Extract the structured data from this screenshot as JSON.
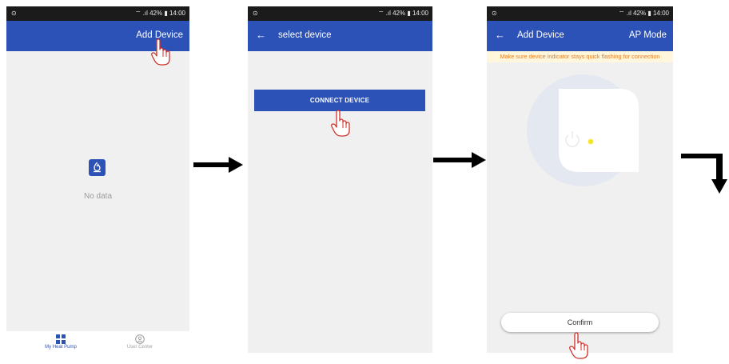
{
  "colors": {
    "accent": "#2c51b7",
    "status_bar": "#1b1b1b",
    "screen_bg": "#f0f0f0",
    "warning_text": "#e67e22",
    "warning_bg": "#fff6dc",
    "pointer_hand": "#d03028",
    "indicator_led": "#f5e52a"
  },
  "status_bar": {
    "left_icons": "⊙",
    "right_text": "⌔ .ıl 42% ▮ 14:00"
  },
  "screen1": {
    "appbar": {
      "action": "Add Device"
    },
    "empty_state": {
      "icon": "heat-pump-icon",
      "text": "No data"
    },
    "tabbar": {
      "tabs": [
        {
          "label": "My Heat Pump",
          "icon": "grid-icon",
          "active": true
        },
        {
          "label": "User Center",
          "icon": "user-circle-icon",
          "active": false
        }
      ]
    }
  },
  "screen2": {
    "appbar": {
      "back": "←",
      "title": "select device"
    },
    "connect_button": "CONNECT DEVICE"
  },
  "screen3": {
    "appbar": {
      "back": "←",
      "title": "Add Device",
      "mode": "AP Mode"
    },
    "warning": "Make sure device indicator stays quick flashing for connection",
    "illustration": {
      "power_icon": "power-icon",
      "indicator": "blinking-led"
    },
    "confirm_button": "Confirm"
  },
  "flow_arrows": [
    "arrow-right-icon",
    "arrow-right-icon",
    "arrow-turn-down-icon"
  ],
  "pointer": "hand-pointer-icon"
}
